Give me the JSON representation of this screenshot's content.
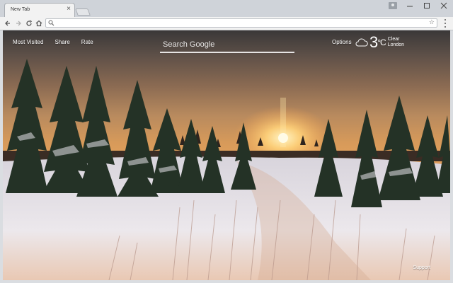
{
  "browser": {
    "tab_title": "New Tab",
    "tab_close": "×",
    "omnibox_value": "",
    "omnibox_placeholder": ""
  },
  "page": {
    "nav": {
      "most_visited": "Most Visited",
      "share": "Share",
      "rate": "Rate"
    },
    "search": {
      "placeholder": "Search Google"
    },
    "options_label": "Options",
    "weather": {
      "temperature": "3",
      "unit": "°C",
      "condition": "Clear",
      "location": "London"
    },
    "support_label": "Support"
  },
  "icons": {
    "back": "arrow-left",
    "forward": "arrow-right",
    "reload": "reload",
    "home": "home",
    "search": "magnifier",
    "star": "star",
    "menu": "vertical-dots",
    "weather": "cloud"
  }
}
